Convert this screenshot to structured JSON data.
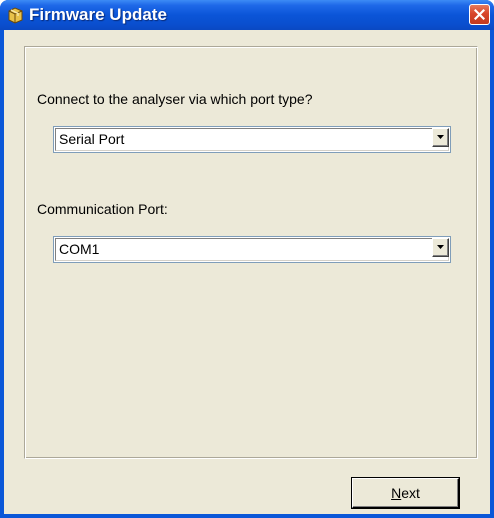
{
  "window": {
    "title": "Firmware Update",
    "title_icon": "package-icon",
    "close_icon": "close-icon"
  },
  "form": {
    "port_type_label": "Connect to the analyser via which port type?",
    "port_type_value": "Serial Port",
    "comm_port_label": "Communication Port:",
    "comm_port_value": "COM1"
  },
  "buttons": {
    "next_mnemonic": "N",
    "next_rest": "ext"
  },
  "colors": {
    "titlebar": "#0a55d8",
    "close_button": "#d8452a",
    "client_background": "#ece9d8"
  }
}
